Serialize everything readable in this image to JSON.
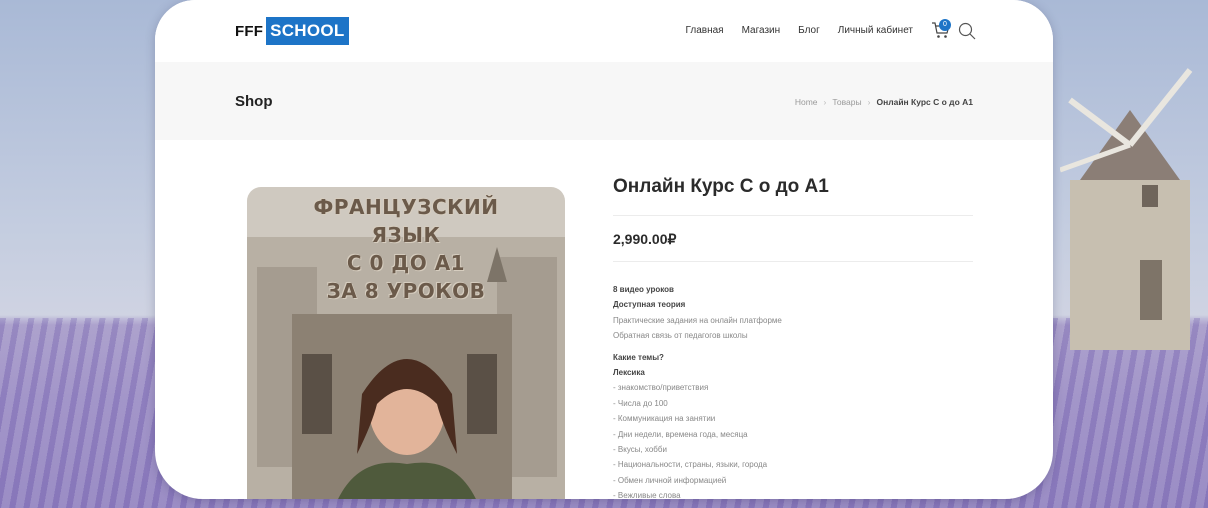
{
  "header": {
    "logo_left": "FFF",
    "logo_right": "SCHOOL",
    "nav": [
      "Главная",
      "Магазин",
      "Блог",
      "Личный кабинет"
    ],
    "cart_count": "0",
    "icons": [
      "cart-icon",
      "search-icon"
    ]
  },
  "titlebar": {
    "title": "Shop",
    "breadcrumb": [
      "Home",
      "Товары",
      "Онлайн Курс С о до А1"
    ]
  },
  "product": {
    "poster_lines": [
      "ФРАНЦУЗСКИЙ",
      "ЯЗЫК",
      "С 0 ДО А1",
      "ЗА 8 УРОКОВ"
    ],
    "title": "Онлайн Курс С о до А1",
    "price": "2,990.00₽",
    "features_bold": [
      "8 видео уроков",
      "Доступная теория"
    ],
    "features": [
      "Практические задания на онлайн платформе",
      "Обратная связь от педагогов школы"
    ],
    "topics_heading": "Какие темы?",
    "lexicon_heading": "Лексика",
    "lexicon_items": [
      "- знакомство/приветствия",
      "- Числа до 100",
      "- Коммуникация на занятии",
      "- Дни недели, времена года, месяца",
      "- Вкусы, хобби",
      "- Национальности, страны, языки, города",
      "- Обмен личной информацией",
      "- Вежливые слова"
    ]
  },
  "colors": {
    "brand": "#1d74c7",
    "text": "#2b2b2b",
    "muted": "#888888"
  }
}
